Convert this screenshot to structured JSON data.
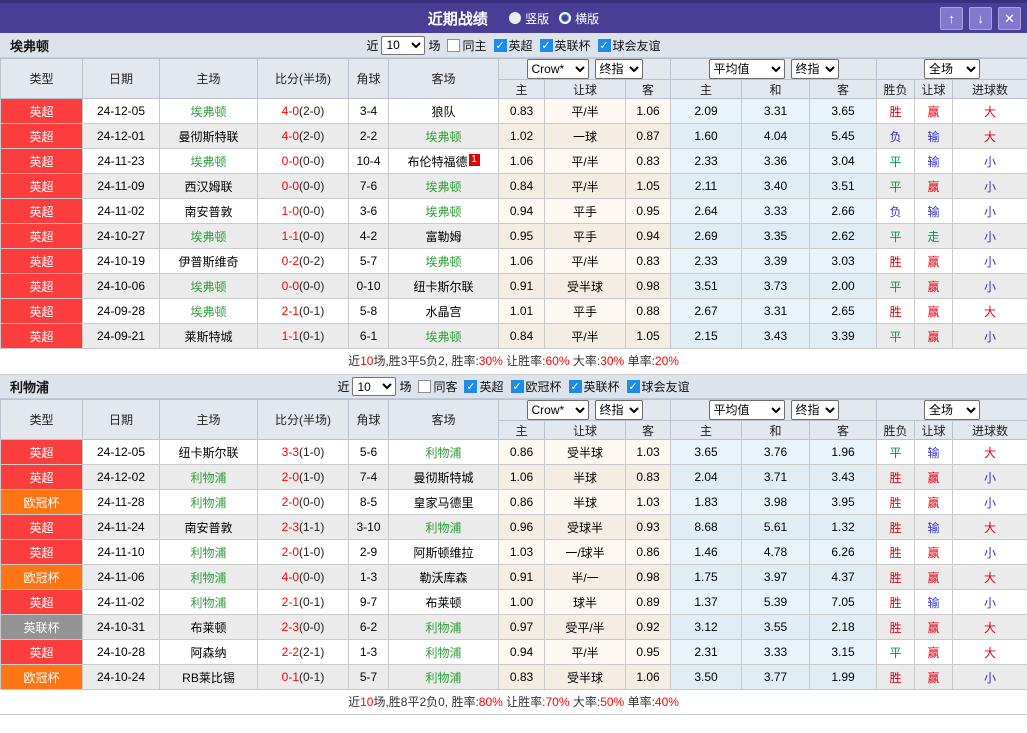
{
  "titlebar": {
    "title": "近期战绩",
    "radios": [
      {
        "label": "竖版",
        "selected": true
      },
      {
        "label": "横版",
        "selected": false
      }
    ],
    "up_button": "↑",
    "down_button": "↓",
    "close_button": "✕"
  },
  "league_colors": {
    "英超": "#fb3d3d",
    "欧冠杯": "#ff7413",
    "英联杯": "#949494"
  },
  "value_colors": {
    "胜": "#e60012",
    "平": "#009944",
    "负": "#3333cc",
    "赢": "#e60012",
    "走": "#009944",
    "输": "#3333cc",
    "大": "#e60012",
    "小": "#3333cc"
  },
  "sections": [
    {
      "team": "埃弗顿",
      "filter": {
        "prefix": "近",
        "count": "10",
        "suffix": "场",
        "same_label": "同主",
        "same_checked": false,
        "leagues": [
          {
            "label": "英超",
            "checked": true
          },
          {
            "label": "英联杯",
            "checked": true
          },
          {
            "label": "球会友谊",
            "checked": true
          }
        ]
      },
      "header": {
        "left_cols": [
          "类型",
          "日期",
          "主场",
          "比分(半场)",
          "角球",
          "客场"
        ],
        "dropdowns": {
          "odds_source": "Crow*",
          "odds_time": "终指",
          "europe_source": "平均值",
          "europe_time": "终指",
          "scope": "全场"
        },
        "sub_cols": [
          "主",
          "让球",
          "客",
          "主",
          "和",
          "客",
          "胜负",
          "让球",
          "进球数"
        ]
      },
      "rows": [
        {
          "league": "英超",
          "date": "24-12-05",
          "home": "埃弗顿",
          "home_self": true,
          "score": "4-0",
          "half": "(2-0)",
          "corner": "3-4",
          "away": "狼队",
          "away_self": false,
          "ah": [
            "0.83",
            "平/半",
            "1.06"
          ],
          "eu": [
            "2.09",
            "3.31",
            "3.65"
          ],
          "res": [
            "胜",
            "赢",
            "大"
          ]
        },
        {
          "league": "英超",
          "date": "24-12-01",
          "home": "曼彻斯特联",
          "home_self": false,
          "score": "4-0",
          "half": "(2-0)",
          "corner": "2-2",
          "away": "埃弗顿",
          "away_self": true,
          "ah": [
            "1.02",
            "一球",
            "0.87"
          ],
          "eu": [
            "1.60",
            "4.04",
            "5.45"
          ],
          "res": [
            "负",
            "输",
            "大"
          ]
        },
        {
          "league": "英超",
          "date": "24-11-23",
          "home": "埃弗顿",
          "home_self": true,
          "score": "0-0",
          "half": "(0-0)",
          "corner": "10-4",
          "away": "布伦特福德",
          "away_self": false,
          "away_badge": "1",
          "ah": [
            "1.06",
            "平/半",
            "0.83"
          ],
          "eu": [
            "2.33",
            "3.36",
            "3.04"
          ],
          "res": [
            "平",
            "输",
            "小"
          ]
        },
        {
          "league": "英超",
          "date": "24-11-09",
          "home": "西汉姆联",
          "home_self": false,
          "score": "0-0",
          "half": "(0-0)",
          "corner": "7-6",
          "away": "埃弗顿",
          "away_self": true,
          "ah": [
            "0.84",
            "平/半",
            "1.05"
          ],
          "eu": [
            "2.11",
            "3.40",
            "3.51"
          ],
          "res": [
            "平",
            "赢",
            "小"
          ]
        },
        {
          "league": "英超",
          "date": "24-11-02",
          "home": "南安普敦",
          "home_self": false,
          "score": "1-0",
          "half": "(0-0)",
          "corner": "3-6",
          "away": "埃弗顿",
          "away_self": true,
          "ah": [
            "0.94",
            "平手",
            "0.95"
          ],
          "eu": [
            "2.64",
            "3.33",
            "2.66"
          ],
          "res": [
            "负",
            "输",
            "小"
          ]
        },
        {
          "league": "英超",
          "date": "24-10-27",
          "home": "埃弗顿",
          "home_self": true,
          "score": "1-1",
          "half": "(0-0)",
          "corner": "4-2",
          "away": "富勒姆",
          "away_self": false,
          "ah": [
            "0.95",
            "平手",
            "0.94"
          ],
          "eu": [
            "2.69",
            "3.35",
            "2.62"
          ],
          "res": [
            "平",
            "走",
            "小"
          ]
        },
        {
          "league": "英超",
          "date": "24-10-19",
          "home": "伊普斯维奇",
          "home_self": false,
          "score": "0-2",
          "half": "(0-2)",
          "corner": "5-7",
          "away": "埃弗顿",
          "away_self": true,
          "ah": [
            "1.06",
            "平/半",
            "0.83"
          ],
          "eu": [
            "2.33",
            "3.39",
            "3.03"
          ],
          "res": [
            "胜",
            "赢",
            "小"
          ]
        },
        {
          "league": "英超",
          "date": "24-10-06",
          "home": "埃弗顿",
          "home_self": true,
          "score": "0-0",
          "half": "(0-0)",
          "corner": "0-10",
          "away": "纽卡斯尔联",
          "away_self": false,
          "ah": [
            "0.91",
            "受半球",
            "0.98"
          ],
          "eu": [
            "3.51",
            "3.73",
            "2.00"
          ],
          "res": [
            "平",
            "赢",
            "小"
          ]
        },
        {
          "league": "英超",
          "date": "24-09-28",
          "home": "埃弗顿",
          "home_self": true,
          "score": "2-1",
          "half": "(0-1)",
          "corner": "5-8",
          "away": "水晶宫",
          "away_self": false,
          "ah": [
            "1.01",
            "平手",
            "0.88"
          ],
          "eu": [
            "2.67",
            "3.31",
            "2.65"
          ],
          "res": [
            "胜",
            "赢",
            "大"
          ]
        },
        {
          "league": "英超",
          "date": "24-09-21",
          "home": "莱斯特城",
          "home_self": false,
          "score": "1-1",
          "half": "(0-1)",
          "corner": "6-1",
          "away": "埃弗顿",
          "away_self": true,
          "ah": [
            "0.84",
            "平/半",
            "1.05"
          ],
          "eu": [
            "2.15",
            "3.43",
            "3.39"
          ],
          "res": [
            "平",
            "赢",
            "小"
          ]
        }
      ],
      "summary_parts": [
        {
          "text": "近"
        },
        {
          "text": "10",
          "red": true
        },
        {
          "text": "场,胜3平5负2, 胜率:"
        },
        {
          "text": "30%",
          "red": true
        },
        {
          "text": " 让胜率:"
        },
        {
          "text": "60%",
          "red": true
        },
        {
          "text": " 大率:"
        },
        {
          "text": "30%",
          "red": true
        },
        {
          "text": " 单率:"
        },
        {
          "text": "20%",
          "red": true
        }
      ]
    },
    {
      "team": "利物浦",
      "filter": {
        "prefix": "近",
        "count": "10",
        "suffix": "场",
        "same_label": "同客",
        "same_checked": false,
        "leagues": [
          {
            "label": "英超",
            "checked": true
          },
          {
            "label": "欧冠杯",
            "checked": true
          },
          {
            "label": "英联杯",
            "checked": true
          },
          {
            "label": "球会友谊",
            "checked": true
          }
        ]
      },
      "header": {
        "left_cols": [
          "类型",
          "日期",
          "主场",
          "比分(半场)",
          "角球",
          "客场"
        ],
        "dropdowns": {
          "odds_source": "Crow*",
          "odds_time": "终指",
          "europe_source": "平均值",
          "europe_time": "终指",
          "scope": "全场"
        },
        "sub_cols": [
          "主",
          "让球",
          "客",
          "主",
          "和",
          "客",
          "胜负",
          "让球",
          "进球数"
        ]
      },
      "rows": [
        {
          "league": "英超",
          "date": "24-12-05",
          "home": "纽卡斯尔联",
          "home_self": false,
          "score": "3-3",
          "half": "(1-0)",
          "corner": "5-6",
          "away": "利物浦",
          "away_self": true,
          "ah": [
            "0.86",
            "受半球",
            "1.03"
          ],
          "eu": [
            "3.65",
            "3.76",
            "1.96"
          ],
          "res": [
            "平",
            "输",
            "大"
          ]
        },
        {
          "league": "英超",
          "date": "24-12-02",
          "home": "利物浦",
          "home_self": true,
          "score": "2-0",
          "half": "(1-0)",
          "corner": "7-4",
          "away": "曼彻斯特城",
          "away_self": false,
          "ah": [
            "1.06",
            "半球",
            "0.83"
          ],
          "eu": [
            "2.04",
            "3.71",
            "3.43"
          ],
          "res": [
            "胜",
            "赢",
            "小"
          ]
        },
        {
          "league": "欧冠杯",
          "date": "24-11-28",
          "home": "利物浦",
          "home_self": true,
          "score": "2-0",
          "half": "(0-0)",
          "corner": "8-5",
          "away": "皇家马德里",
          "away_self": false,
          "ah": [
            "0.86",
            "半球",
            "1.03"
          ],
          "eu": [
            "1.83",
            "3.98",
            "3.95"
          ],
          "res": [
            "胜",
            "赢",
            "小"
          ]
        },
        {
          "league": "英超",
          "date": "24-11-24",
          "home": "南安普敦",
          "home_self": false,
          "score": "2-3",
          "half": "(1-1)",
          "corner": "3-10",
          "away": "利物浦",
          "away_self": true,
          "ah": [
            "0.96",
            "受球半",
            "0.93"
          ],
          "eu": [
            "8.68",
            "5.61",
            "1.32"
          ],
          "res": [
            "胜",
            "输",
            "大"
          ]
        },
        {
          "league": "英超",
          "date": "24-11-10",
          "home": "利物浦",
          "home_self": true,
          "score": "2-0",
          "half": "(1-0)",
          "corner": "2-9",
          "away": "阿斯顿维拉",
          "away_self": false,
          "ah": [
            "1.03",
            "一/球半",
            "0.86"
          ],
          "eu": [
            "1.46",
            "4.78",
            "6.26"
          ],
          "res": [
            "胜",
            "赢",
            "小"
          ]
        },
        {
          "league": "欧冠杯",
          "date": "24-11-06",
          "home": "利物浦",
          "home_self": true,
          "score": "4-0",
          "half": "(0-0)",
          "corner": "1-3",
          "away": "勒沃库森",
          "away_self": false,
          "ah": [
            "0.91",
            "半/一",
            "0.98"
          ],
          "eu": [
            "1.75",
            "3.97",
            "4.37"
          ],
          "res": [
            "胜",
            "赢",
            "大"
          ]
        },
        {
          "league": "英超",
          "date": "24-11-02",
          "home": "利物浦",
          "home_self": true,
          "score": "2-1",
          "half": "(0-1)",
          "corner": "9-7",
          "away": "布莱顿",
          "away_self": false,
          "ah": [
            "1.00",
            "球半",
            "0.89"
          ],
          "eu": [
            "1.37",
            "5.39",
            "7.05"
          ],
          "res": [
            "胜",
            "输",
            "小"
          ]
        },
        {
          "league": "英联杯",
          "date": "24-10-31",
          "home": "布莱顿",
          "home_self": false,
          "score": "2-3",
          "half": "(0-0)",
          "corner": "6-2",
          "away": "利物浦",
          "away_self": true,
          "ah": [
            "0.97",
            "受平/半",
            "0.92"
          ],
          "eu": [
            "3.12",
            "3.55",
            "2.18"
          ],
          "res": [
            "胜",
            "赢",
            "大"
          ]
        },
        {
          "league": "英超",
          "date": "24-10-28",
          "home": "阿森纳",
          "home_self": false,
          "score": "2-2",
          "half": "(2-1)",
          "corner": "1-3",
          "away": "利物浦",
          "away_self": true,
          "ah": [
            "0.94",
            "平/半",
            "0.95"
          ],
          "eu": [
            "2.31",
            "3.33",
            "3.15"
          ],
          "res": [
            "平",
            "赢",
            "大"
          ]
        },
        {
          "league": "欧冠杯",
          "date": "24-10-24",
          "home": "RB莱比锡",
          "home_self": false,
          "score": "0-1",
          "half": "(0-1)",
          "corner": "5-7",
          "away": "利物浦",
          "away_self": true,
          "ah": [
            "0.83",
            "受半球",
            "1.06"
          ],
          "eu": [
            "3.50",
            "3.77",
            "1.99"
          ],
          "res": [
            "胜",
            "赢",
            "小"
          ]
        }
      ],
      "summary_parts": [
        {
          "text": "近"
        },
        {
          "text": "10",
          "red": true
        },
        {
          "text": "场,胜8平2负0, 胜率:"
        },
        {
          "text": "80%",
          "red": true
        },
        {
          "text": " 让胜率:"
        },
        {
          "text": "70%",
          "red": true
        },
        {
          "text": " 大率:"
        },
        {
          "text": "50%",
          "red": true
        },
        {
          "text": " 单率:"
        },
        {
          "text": "40%",
          "red": true
        }
      ]
    }
  ]
}
